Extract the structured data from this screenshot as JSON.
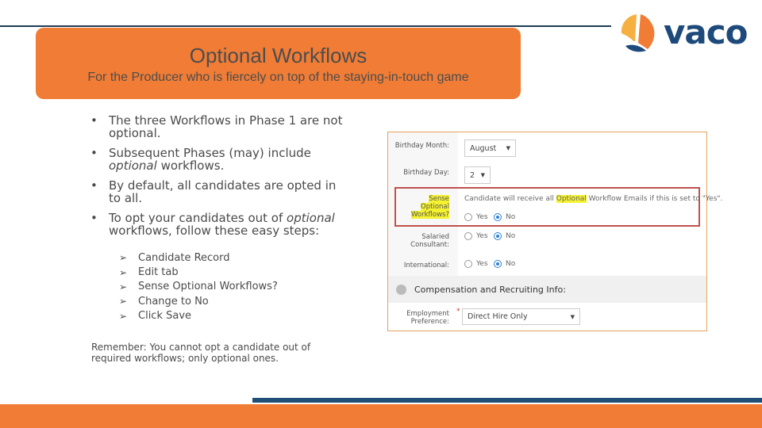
{
  "header": {
    "title": "Optional Workflows",
    "subtitle": "For the Producer who is fiercely on top of the staying-in-touch game"
  },
  "logo": {
    "text": "vaco",
    "brand_color": "#1d4a7a",
    "accent_orange": "#f07c35",
    "accent_yellow": "#f6b042"
  },
  "bullets": [
    {
      "parts": [
        {
          "text": "The three Workflows in Phase 1 are not optional.",
          "italic": false
        }
      ]
    },
    {
      "parts": [
        {
          "text": "Subsequent Phases (may) include ",
          "italic": false
        },
        {
          "text": "optional",
          "italic": true
        },
        {
          "text": " workflows.",
          "italic": false
        }
      ]
    },
    {
      "parts": [
        {
          "text": "By default, all candidates are opted in to all.",
          "italic": false
        }
      ]
    },
    {
      "parts": [
        {
          "text": "To opt your candidates out of ",
          "italic": false
        },
        {
          "text": "optional",
          "italic": true
        },
        {
          "text": " workflows, follow these easy steps:",
          "italic": false
        }
      ]
    }
  ],
  "bullet_glyph": "•",
  "step_glyph": "➢",
  "steps": [
    "Candidate Record",
    "Edit tab",
    "Sense Optional Workflows?",
    "Change to No",
    "Click Save"
  ],
  "remember": "Remember: You cannot opt a candidate out of required workflows; only optional ones.",
  "screenshot": {
    "birthday_month": {
      "label": "Birthday Month:",
      "value": "August"
    },
    "birthday_day": {
      "label": "Birthday Day:",
      "value": "2"
    },
    "sense_optional": {
      "label_line1": "Sense Optional",
      "label_line2": "Workflows?",
      "desc_before": "Candidate will receive all ",
      "desc_highlight": "Optional",
      "desc_after": " Workflow Emails if this is set to \"Yes\".",
      "yes": "Yes",
      "no": "No",
      "selected": "No"
    },
    "salaried": {
      "label_line1": "Salaried",
      "label_line2": "Consultant:",
      "yes": "Yes",
      "no": "No",
      "selected": "No"
    },
    "international": {
      "label": "International:",
      "yes": "Yes",
      "no": "No",
      "selected": "No"
    },
    "section_title": "Compensation and Recruiting Info:",
    "employment": {
      "label_line1": "Employment",
      "label_line2": "Preference:",
      "required_mark": "*",
      "value": "Direct Hire Only"
    },
    "caret": "▼"
  }
}
